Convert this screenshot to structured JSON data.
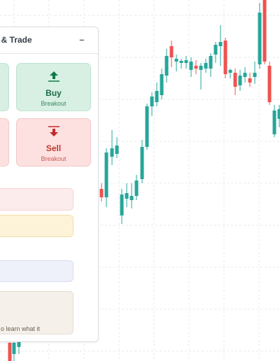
{
  "panel": {
    "title": "w & Trade",
    "minimize_label": "–",
    "buy_card": {
      "label": "Buy",
      "subtitle": "Breakout"
    },
    "sell_card": {
      "label": "Sell",
      "subtitle": "Breakout"
    },
    "learn_text": "o learn what it"
  },
  "colors": {
    "bull": "#26a69a",
    "bear": "#ef5350",
    "buy_bg": "#d7f0e3",
    "sell_bg": "#fde1e1",
    "pink_bar": "#fdecec",
    "yellow_bar": "#fdf3d8",
    "blue_bar": "#eef0fa",
    "beige_box": "#f5f0ea"
  },
  "icons": {
    "buy": "arrow-up-icon",
    "sell": "arrow-down-icon"
  }
}
